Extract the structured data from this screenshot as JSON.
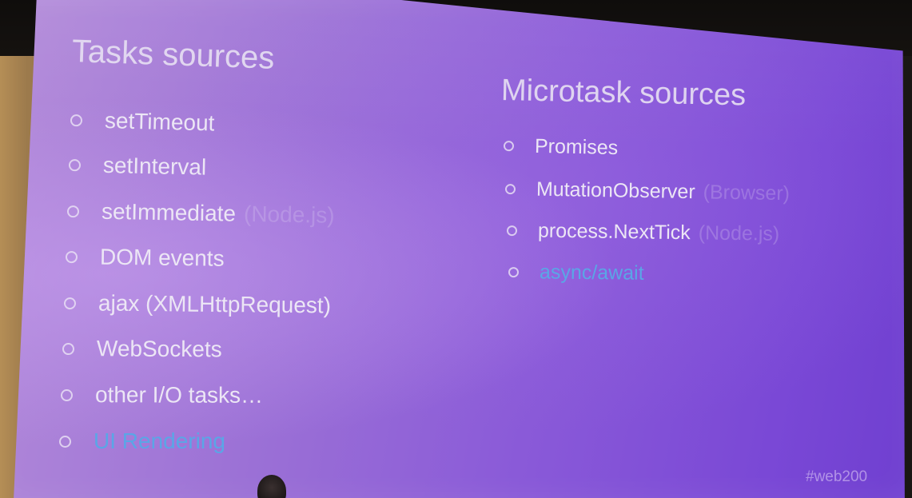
{
  "slide": {
    "left_title": "Tasks sources",
    "right_title": "Microtask sources",
    "task_sources": [
      {
        "label": "setTimeout",
        "note": ""
      },
      {
        "label": "setInterval",
        "note": ""
      },
      {
        "label": "setImmediate",
        "note": "(Node.js)"
      },
      {
        "label": "DOM events",
        "note": ""
      },
      {
        "label": "ajax (XMLHttpRequest)",
        "note": ""
      },
      {
        "label": "WebSockets",
        "note": ""
      },
      {
        "label": "other I/O tasks…",
        "note": ""
      },
      {
        "label": "UI Rendering",
        "note": ""
      }
    ],
    "microtask_sources": [
      {
        "label": "Promises",
        "note": ""
      },
      {
        "label": "MutationObserver",
        "note": "(Browser)"
      },
      {
        "label": "process.NextTick",
        "note": "(Node.js)"
      },
      {
        "label": "async/await",
        "note": ""
      }
    ],
    "hashtag": "#web200"
  },
  "colors": {
    "slide_background": "#8a5ad8",
    "text": "#ece6f5",
    "highlight": "#5aa6e6"
  }
}
